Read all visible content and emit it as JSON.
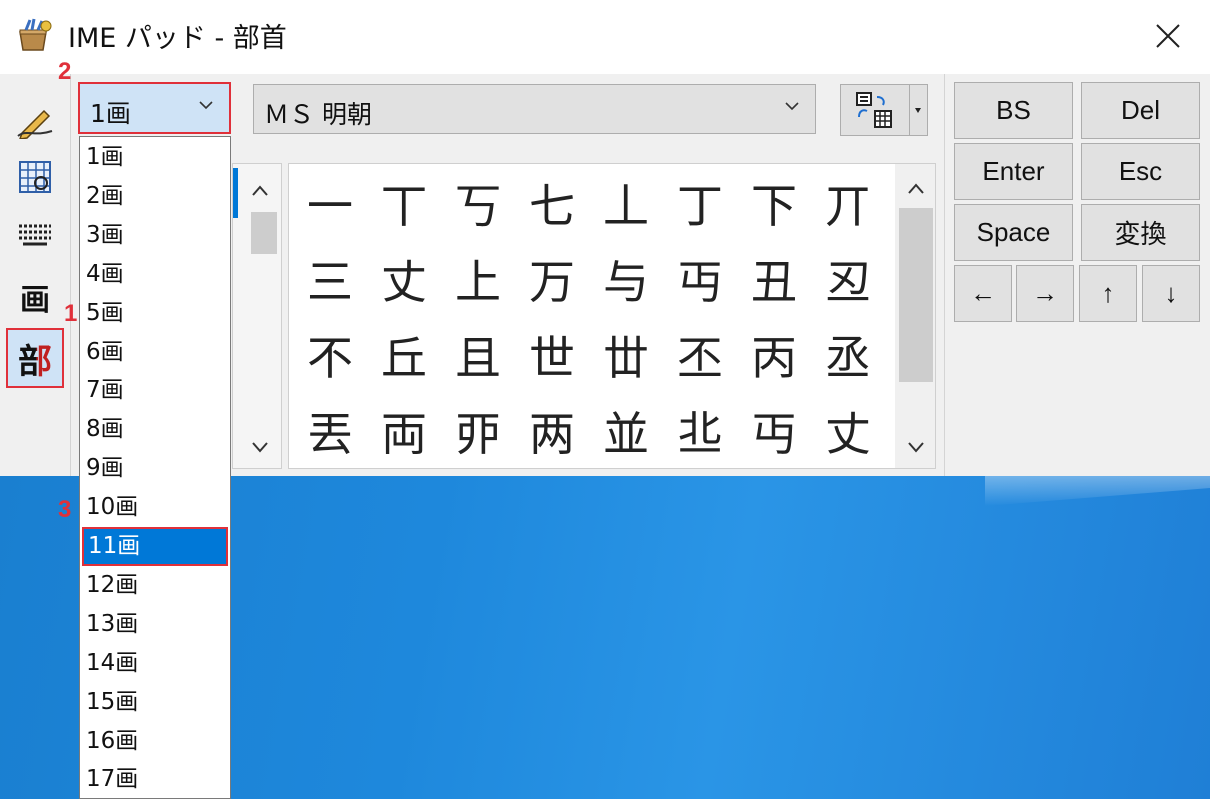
{
  "window": {
    "title": "IME パッド - 部首",
    "close_icon": "close-icon"
  },
  "toolbar": {
    "items": [
      {
        "name": "handwriting",
        "icon": "pen-icon"
      },
      {
        "name": "character-list",
        "icon": "table-icon"
      },
      {
        "name": "soft-keyboard",
        "icon": "keyboard-icon"
      },
      {
        "name": "stroke-count",
        "label": "画"
      },
      {
        "name": "radical",
        "label": "部",
        "selected": true
      }
    ]
  },
  "stroke_combo": {
    "value": "1画"
  },
  "font_combo": {
    "value": "ＭＳ 明朝"
  },
  "dropdown": {
    "options": [
      "1画",
      "2画",
      "3画",
      "4画",
      "5画",
      "6画",
      "7画",
      "8画",
      "9画",
      "10画",
      "11画",
      "12画",
      "13画",
      "14画",
      "15画",
      "16画",
      "17画"
    ],
    "highlighted_index": 10
  },
  "characters": [
    [
      "一",
      "丅",
      "丂",
      "七",
      "丄",
      "丁",
      "下",
      "丌"
    ],
    [
      "三",
      "丈",
      "上",
      "万",
      "与",
      "丏",
      "丑",
      "丒"
    ],
    [
      "不",
      "丘",
      "且",
      "世",
      "丗",
      "丕",
      "丙",
      "丞"
    ],
    [
      "丟",
      "両",
      "丣",
      "两",
      "並",
      "丠",
      "丏",
      "丈"
    ]
  ],
  "keys": {
    "bs": "BS",
    "del": "Del",
    "enter": "Enter",
    "esc": "Esc",
    "space": "Space",
    "convert": "変換",
    "left": "←",
    "right": "→",
    "up": "↑",
    "down": "↓"
  },
  "steps": {
    "one": "1",
    "two": "2",
    "three": "3"
  },
  "colors": {
    "accent": "#0078d7",
    "annotation": "#e0303a",
    "desktop": "#1e88dc"
  }
}
